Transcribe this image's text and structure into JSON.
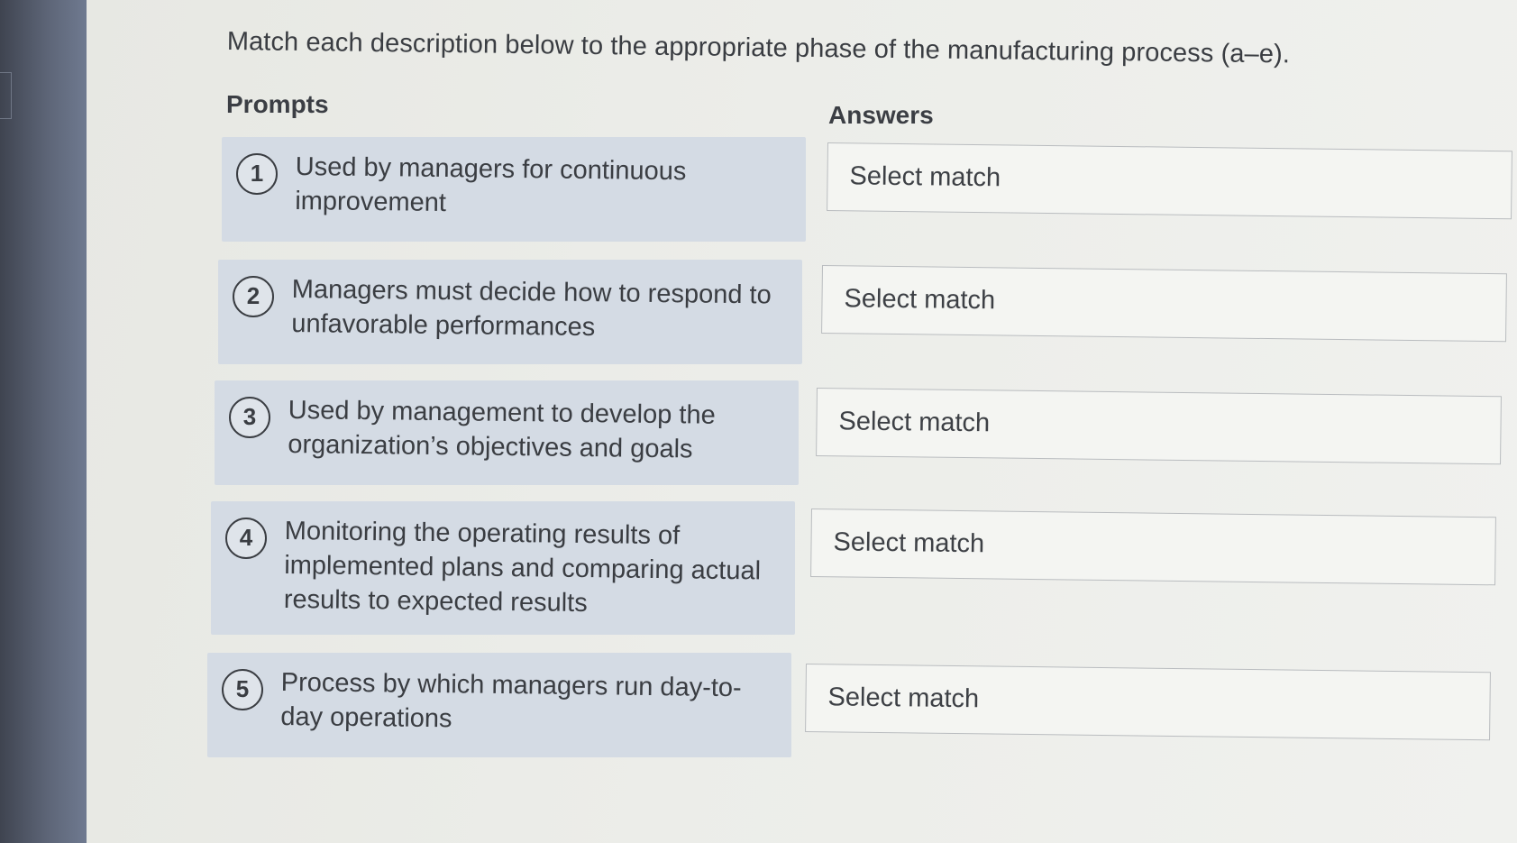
{
  "instruction": "Match each description below to the appropriate phase of the manufacturing process (a–e).",
  "columns": {
    "prompts": "Prompts",
    "answers": "Answers"
  },
  "items": [
    {
      "number": "1",
      "prompt": "Used by managers for continuous improvement",
      "answer": "Select match"
    },
    {
      "number": "2",
      "prompt": "Managers must decide how to respond to unfavorable performances",
      "answer": "Select match"
    },
    {
      "number": "3",
      "prompt": "Used by management to develop the organization’s objectives and goals",
      "answer": "Select match"
    },
    {
      "number": "4",
      "prompt": "Monitoring the operating results of implemented plans and comparing actual results to expected results",
      "answer": "Select match"
    },
    {
      "number": "5",
      "prompt": "Process by which managers run day-to-day operations",
      "answer": "Select match"
    }
  ],
  "colors": {
    "prompt_card_bg": "#d4dbe4",
    "text": "#3a3d42",
    "bezel": "#5d6577"
  }
}
